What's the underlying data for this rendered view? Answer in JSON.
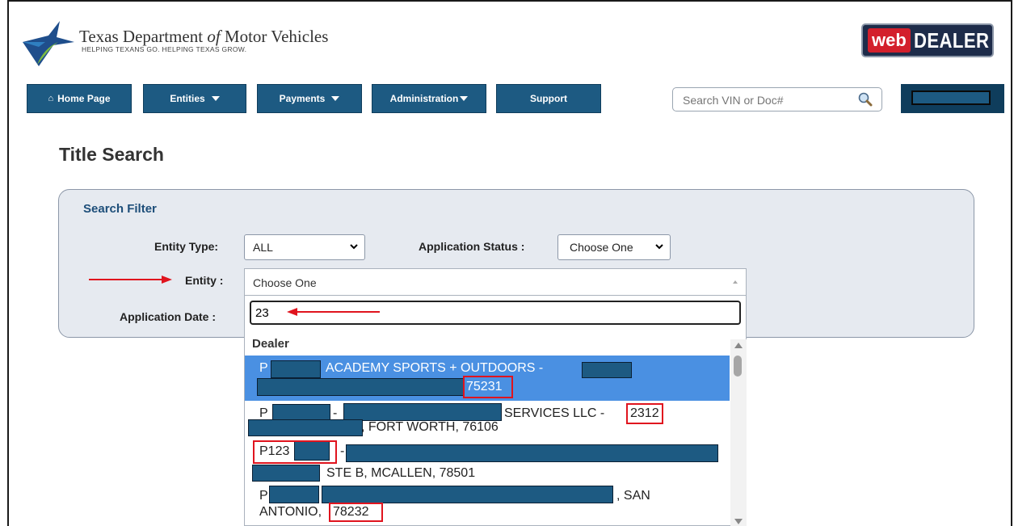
{
  "header": {
    "org_name_part1": "Texas Department ",
    "org_name_of": "of",
    "org_name_part2": " Motor Vehicles",
    "tagline": "HELPING TEXANS GO. HELPING TEXAS GROW.",
    "brand_web": "web",
    "brand_dealer": "DEALER"
  },
  "nav": {
    "home": "Home Page",
    "entities": "Entities",
    "payments": "Payments",
    "administration": "Administration",
    "support": "Support",
    "search_placeholder": "Search VIN or Doc#"
  },
  "page": {
    "title": "Title Search"
  },
  "filter": {
    "title": "Search Filter",
    "entity_type_label": "Entity Type:",
    "entity_type_value": "ALL",
    "application_status_label": "Application Status :",
    "application_status_value": "Choose One",
    "entity_label": "Entity :",
    "entity_value": "Choose One",
    "application_date_label": "Application Date :"
  },
  "dropdown": {
    "search_text": "23",
    "group": "Dealer",
    "options": [
      {
        "line1_a": "P",
        "line1_b": "ACADEMY SPORTS + OUTDOORS -",
        "line2": "75231"
      },
      {
        "line1_a": "P",
        "line1_b": "-",
        "line1_c": "SERVICES LLC -",
        "line1_d": "2312",
        "line2": ", FORT WORTH, 76106"
      },
      {
        "line1_a": "P123",
        "line1_b": "-",
        "line2": "STE B, MCALLEN, 78501"
      },
      {
        "line1_a": "P",
        "line1_b": ", SAN",
        "line2_a": "ANTONIO,",
        "line2_b": "78232"
      }
    ]
  },
  "colors": {
    "nav_blue": "#1d5a82",
    "highlight": "#4a90e2",
    "annotation_red": "#e0141e"
  }
}
